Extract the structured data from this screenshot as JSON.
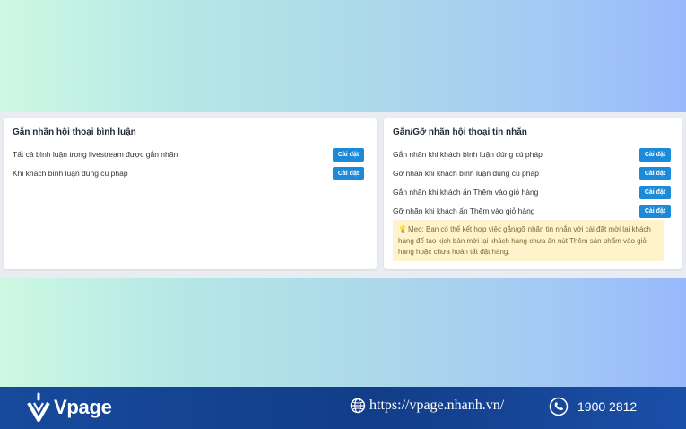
{
  "left_panel": {
    "title": "Gắn nhãn hội thoại bình luận",
    "rows": [
      {
        "label": "Tất cả bình luận trong livestream được gắn nhãn",
        "button": "Cài đặt"
      },
      {
        "label": "Khi khách bình luận đúng cú pháp",
        "button": "Cài đặt"
      }
    ]
  },
  "right_panel": {
    "title": "Gắn/Gỡ nhãn hội thoại tin nhắn",
    "rows": [
      {
        "label": "Gắn nhãn khi khách bình luận đúng cú pháp",
        "button": "Cài đặt"
      },
      {
        "label": "Gỡ nhãn khi khách bình luận đúng cú pháp",
        "button": "Cài đặt"
      },
      {
        "label": "Gắn nhãn khi khách ấn Thêm vào giỏ hàng",
        "button": "Cài đặt"
      },
      {
        "label": "Gỡ nhãn khi khách ấn Thêm vào giỏ hàng",
        "button": "Cài đặt"
      }
    ],
    "tip": "Mẹo: Bạn có thể kết hợp việc gắn/gỡ nhãn tin nhắn với cài đặt mời lại khách hàng để tạo kịch bản mời lại khách hàng chưa ấn nút Thêm sản phẩm vào giỏ hàng hoặc chưa hoàn tất đặt hàng."
  },
  "footer": {
    "brand": "Vpage",
    "website": "https://vpage.nhanh.vn/",
    "phone": "1900 2812",
    "icons": {
      "logo": "vpage-logo-icon",
      "web": "globe-icon",
      "phone": "phone-icon",
      "tip": "lightbulb-icon"
    }
  },
  "colors": {
    "button": "#1c8ad7",
    "tip_bg": "#fff3cc",
    "footer": "#123d88"
  }
}
